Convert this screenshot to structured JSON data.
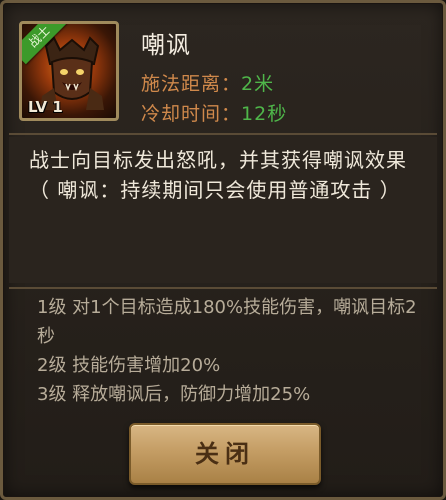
{
  "skill": {
    "badge": "战士",
    "level": "LV 1",
    "name": "嘲讽",
    "range_label": "施法距离：",
    "range_value": "2米",
    "cooldown_label": "冷却时间：",
    "cooldown_value": "12秒",
    "icon": "roaring-warrior-icon"
  },
  "description": {
    "line1": "战士向目标发出怒吼，并其获得嘲讽效果",
    "line2": "（ 嘲讽：持续期间只会使用普通攻击 ）"
  },
  "levels": [
    "1级 对1个目标造成180%技能伤害，嘲讽目标2秒",
    "2级 技能伤害增加20%",
    "3级 释放嘲讽后，防御力增加25%"
  ],
  "close_button": {
    "label": "关闭"
  },
  "colors": {
    "panel_border": "#6b5a3e",
    "stat_label": "#d0894b",
    "stat_value": "#4fb64a",
    "badge": "#3c9a2a",
    "button": "#c49d64"
  }
}
